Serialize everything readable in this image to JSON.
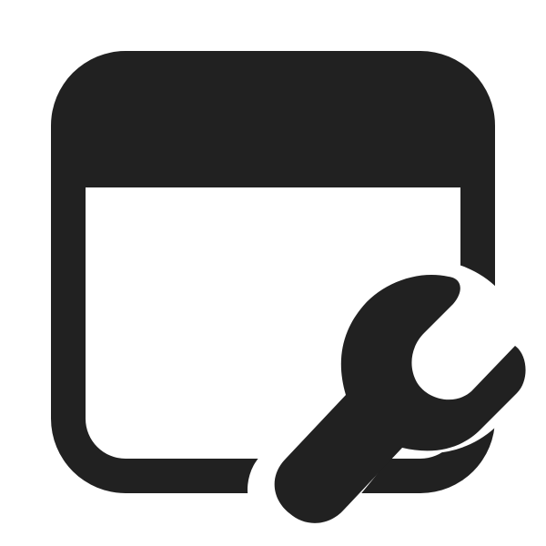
{
  "icon": {
    "name": "app-settings-icon",
    "parts": [
      "window-frame-icon",
      "wrench-icon"
    ],
    "colors": {
      "glyph": "#212121",
      "background": "#ffffff"
    }
  }
}
